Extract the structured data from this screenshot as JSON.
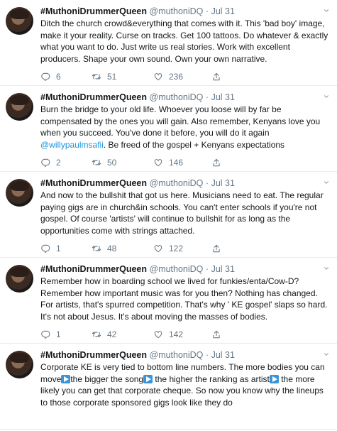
{
  "tweets": [
    {
      "name": "#MuthoniDrummerQueen",
      "handle": "@muthoniDQ",
      "date": "Jul 31",
      "text_before": "Ditch the church crowd&everything that comes with it. This 'bad boy' image, make it your reality. Curse on tracks. Get 100 tattoos. Do whatever & exactly what you want to do. Just write us real stories. Work with excellent producers. Shape your own sound. Own your own narrative.",
      "replies": "6",
      "retweets": "51",
      "likes": "236"
    },
    {
      "name": "#MuthoniDrummerQueen",
      "handle": "@muthoniDQ",
      "date": "Jul 31",
      "text_before": "Burn the bridge to your old life. Whoever you loose will by far be compensated by the ones you will gain. Also remember, Kenyans love you when you succeed. You've done it before, you will do it again ",
      "mention": "@willypaulmsafii",
      "text_after": ". Be freed of the gospel + Kenyans expectations",
      "replies": "2",
      "retweets": "50",
      "likes": "146"
    },
    {
      "name": "#MuthoniDrummerQueen",
      "handle": "@muthoniDQ",
      "date": "Jul 31",
      "text_before": "And now to the bullshit that got us here. Musicians need to eat. The regular paying gigs are in church&in schools. You can't enter schools if you're not gospel. Of course 'artists' will continue to bullshit for as long as the opportunities come with strings attached.",
      "replies": "1",
      "retweets": "48",
      "likes": "122"
    },
    {
      "name": "#MuthoniDrummerQueen",
      "handle": "@muthoniDQ",
      "date": "Jul 31",
      "text_before": "Remember how in boarding school we lived for funkies/enta/Cow-D? Remember how important music was for you then? Nothing has changed. For artists, that's spurred competition. That's why ' KE gospel' slaps so hard. It's not about Jesus. It's about moving the masses of bodies.",
      "replies": "1",
      "retweets": "42",
      "likes": "142"
    },
    {
      "name": "#MuthoniDrummerQueen",
      "handle": "@muthoniDQ",
      "date": "Jul 31",
      "seg1": "Corporate KE is very tied to bottom line numbers. The more bodies you can move",
      "seg2": "the bigger the song",
      "seg3": " the higher the ranking as artist",
      "seg4": " the more likely you can get that corporate cheque. So now you know why the lineups to those corporate sponsored gigs look like they do"
    }
  ],
  "colors": {
    "accent": "#1b95e0",
    "muted": "#657786",
    "play_icon": "#3b94d9"
  },
  "icons": [
    "reply-icon",
    "retweet-icon",
    "like-icon",
    "share-icon",
    "caret-down-icon",
    "play-button-emoji"
  ]
}
